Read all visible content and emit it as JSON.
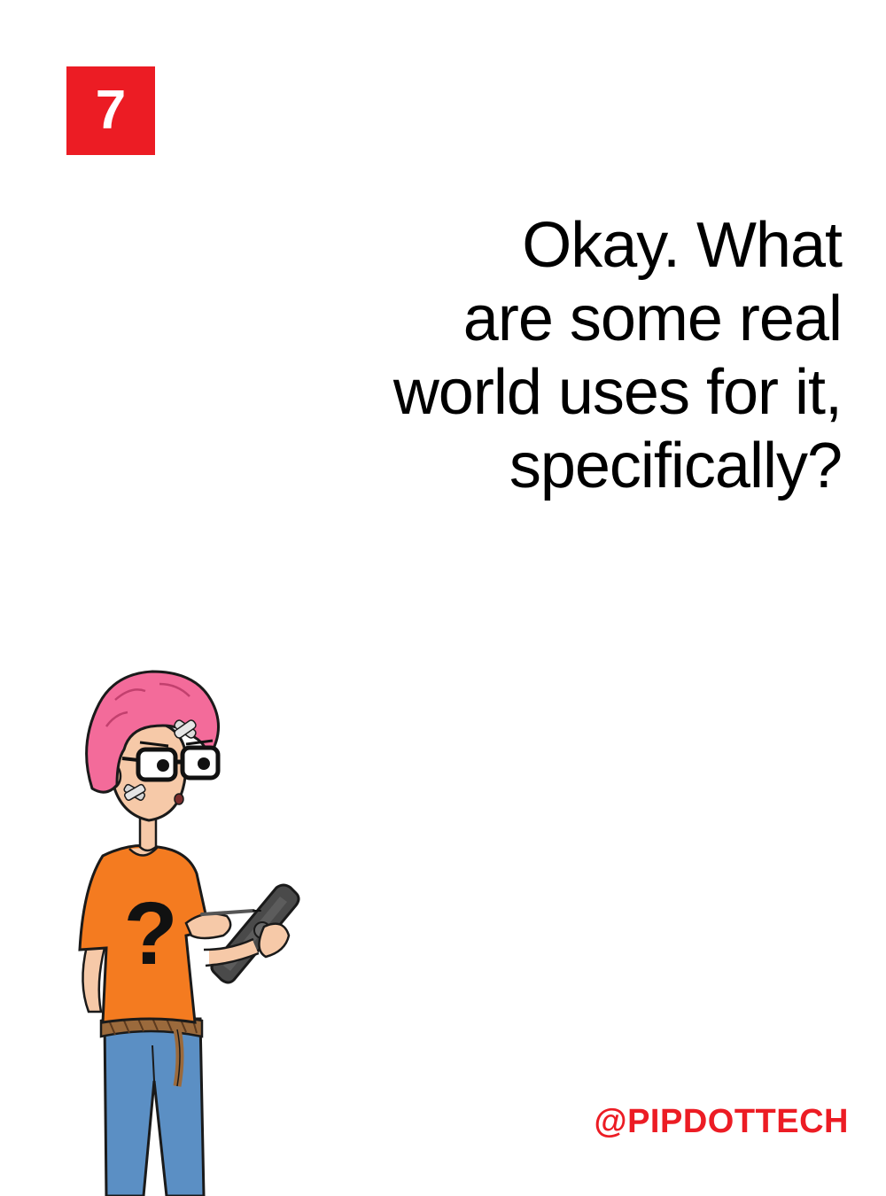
{
  "slide": {
    "number": "7",
    "question_lines": [
      "Okay. What",
      "are some real",
      "world uses for it,",
      "specifically?"
    ],
    "handle": "@PIPDOTTECH"
  },
  "colors": {
    "accent": "#ec1c24",
    "text": "#000000",
    "background": "#ffffff",
    "hair": "#f36b9a",
    "shirt": "#f47b20",
    "jeans": "#5b8fc4",
    "tablet": "#4a4a4a"
  },
  "illustration": {
    "subject": "pink-haired character with glasses holding a tablet and stylus",
    "shirt_symbol": "?"
  }
}
